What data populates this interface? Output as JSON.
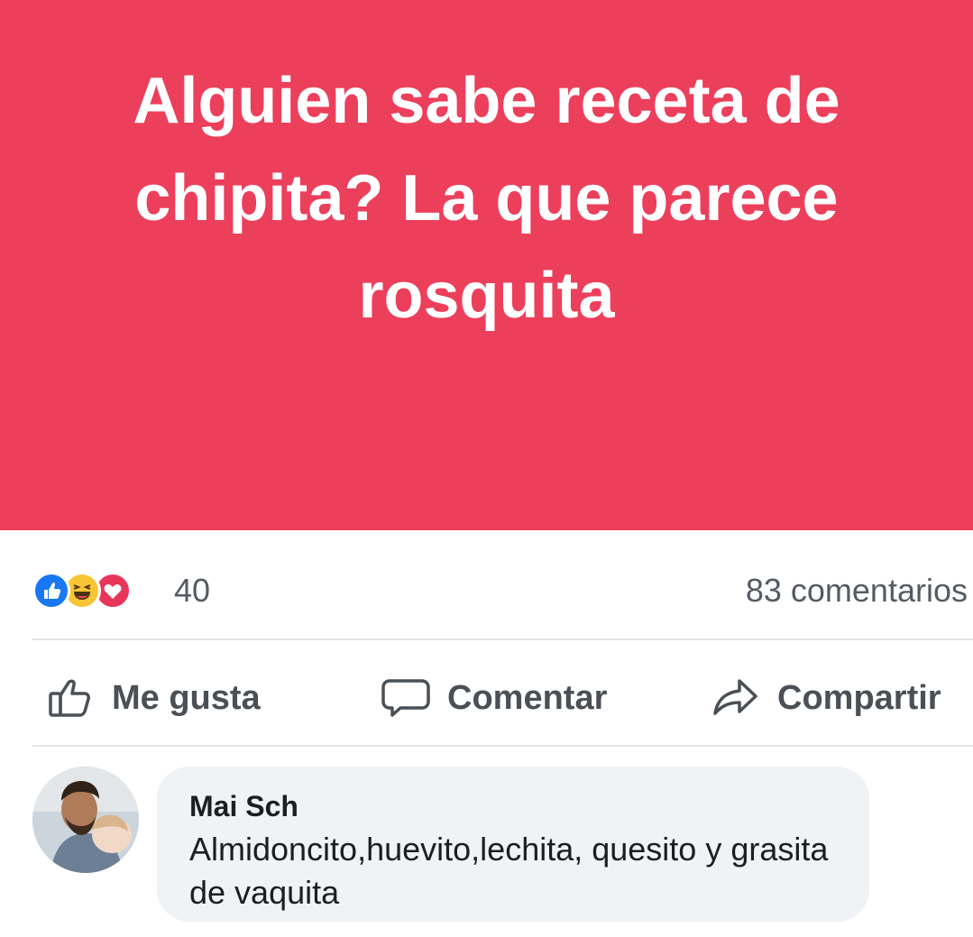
{
  "post": {
    "text": "Alguien sabe receta de chipita? La que parece rosquita",
    "background_color": "#ec3f5b"
  },
  "reactions": {
    "icons": [
      "like-icon",
      "haha-icon",
      "love-icon"
    ],
    "count": "40",
    "comments": "83 comentarios"
  },
  "actions": {
    "like": "Me gusta",
    "comment": "Comentar",
    "share": "Compartir"
  },
  "comment": {
    "author": "Mai Sch",
    "text": "Almidoncito,huevito,lechita, quesito y grasita de vaquita"
  }
}
